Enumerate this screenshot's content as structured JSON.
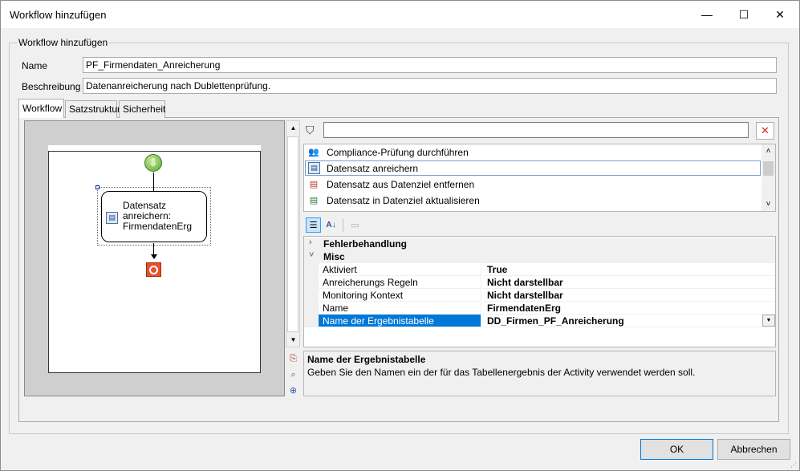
{
  "window": {
    "title": "Workflow hinzufügen",
    "minimize_glyph": "—",
    "maximize_glyph": "☐",
    "close_glyph": "✕"
  },
  "group": {
    "label": "Workflow hinzufügen"
  },
  "form": {
    "name_label": "Name",
    "name_value": "PF_Firmendaten_Anreicherung",
    "desc_label": "Beschreibung",
    "desc_value": "Datenanreicherung nach Dublettenprüfung."
  },
  "tabs": [
    "Workflow",
    "Satzstruktur",
    "Sicherheit"
  ],
  "designer": {
    "activity_label_lines": [
      "Datensatz",
      "anreichern:",
      "FirmendatenErg"
    ],
    "start_icon": "start-arrow-icon",
    "stop_icon": "stop-icon"
  },
  "activities": [
    {
      "label": "Compliance-Prüfung durchführen",
      "icon": "users-icon"
    },
    {
      "label": "Datensatz anreichern",
      "icon": "enrich-record-icon"
    },
    {
      "label": "Datensatz aus Datenziel entfernen",
      "icon": "remove-record-icon"
    },
    {
      "label": "Datensatz in Datenziel aktualisieren",
      "icon": "update-record-icon"
    }
  ],
  "properties": {
    "categories": [
      "Fehlerbehandlung",
      "Misc"
    ],
    "rows": [
      {
        "name": "Aktiviert",
        "value": "True"
      },
      {
        "name": "Anreicherungs Regeln",
        "value": "Nicht darstellbar"
      },
      {
        "name": "Monitoring Kontext",
        "value": "Nicht darstellbar"
      },
      {
        "name": "Name",
        "value": "FirmendatenErg"
      },
      {
        "name": "Name der Ergebnistabelle",
        "value": "DD_Firmen_PF_Anreicherung"
      }
    ],
    "selected_index": 4
  },
  "description": {
    "title": "Name der Ergebnistabelle",
    "text": "Geben Sie den Namen ein der für das Tabellenergebnis der Activity verwendet werden soll."
  },
  "buttons": {
    "ok": "OK",
    "cancel": "Abbrechen"
  },
  "colors": {
    "selection": "#0078d7",
    "stop": "#e8512d",
    "start": "#5aa52a"
  }
}
